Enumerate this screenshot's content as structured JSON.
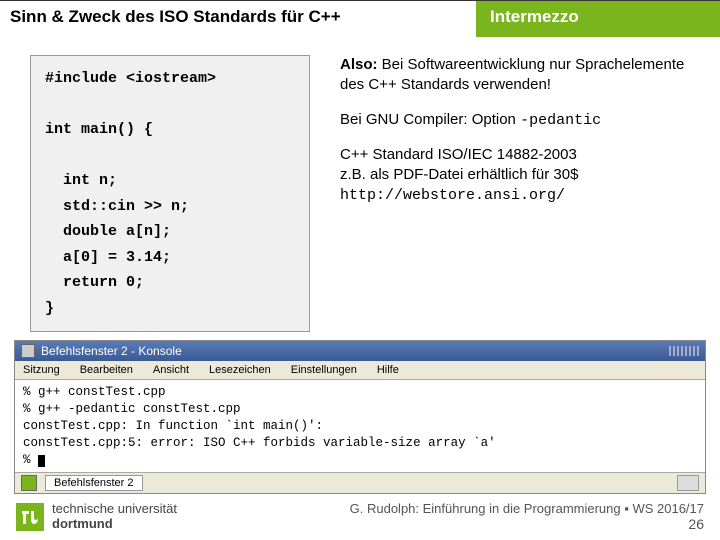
{
  "header": {
    "title": "Sinn & Zweck des ISO Standards für C++",
    "badge": "Intermezzo"
  },
  "code": "#include <iostream>\n\nint main() {\n\n  int n;\n  std::cin >> n;\n  double a[n];\n  a[0] = 3.14;\n  return 0;\n}",
  "rt": {
    "also_b": "Also:",
    "also_rest": " Bei Softwareentwicklung nur Sprachelemente des C++ Standards verwenden!",
    "gnu_pre": "Bei GNU Compiler: Option ",
    "gnu_opt": "-pedantic",
    "std1": "C++ Standard ISO/IEC 14882-2003",
    "std2": "z.B. als PDF-Datei erhältlich für 30$",
    "url": "http://webstore.ansi.org/"
  },
  "term": {
    "title": "Befehlsfenster 2 - Konsole",
    "menu": [
      "Sitzung",
      "Bearbeiten",
      "Ansicht",
      "Lesezeichen",
      "Einstellungen",
      "Hilfe"
    ],
    "body": "% g++ constTest.cpp\n% g++ -pedantic constTest.cpp\nconstTest.cpp: In function `int main()':\nconstTest.cpp:5: error: ISO C++ forbids variable-size array `a'\n% ",
    "tab": "Befehlsfenster 2"
  },
  "foot": {
    "uni1": "technische universität",
    "uni2": "dortmund",
    "credit": "G. Rudolph: Einführung in die Programmierung ▪ WS 2016/17",
    "page": "26"
  }
}
